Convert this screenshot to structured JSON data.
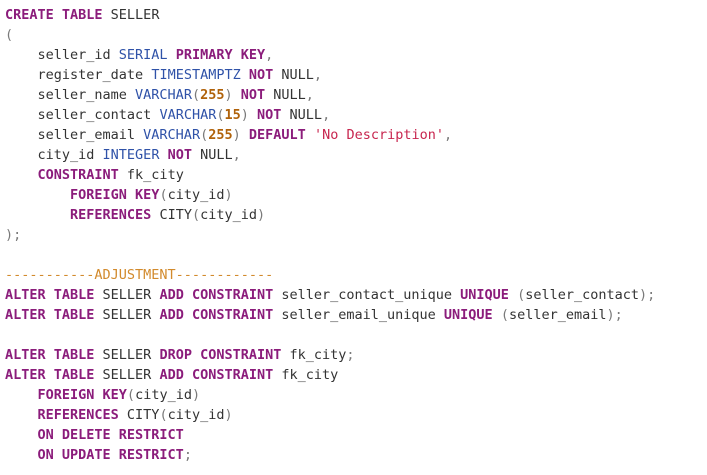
{
  "lines": [
    [
      {
        "t": "CREATE TABLE",
        "c": "kw"
      },
      {
        "t": " SELLER",
        "c": "id"
      }
    ],
    [
      {
        "t": "(",
        "c": "pun"
      }
    ],
    [
      {
        "t": "    seller_id ",
        "c": "id"
      },
      {
        "t": "SERIAL",
        "c": "ty"
      },
      {
        "t": " ",
        "c": "pl"
      },
      {
        "t": "PRIMARY KEY",
        "c": "kw"
      },
      {
        "t": ",",
        "c": "pun"
      }
    ],
    [
      {
        "t": "    register_date ",
        "c": "id"
      },
      {
        "t": "TIMESTAMPTZ",
        "c": "ty"
      },
      {
        "t": " ",
        "c": "pl"
      },
      {
        "t": "NOT",
        "c": "kw"
      },
      {
        "t": " NULL",
        "c": "id"
      },
      {
        "t": ",",
        "c": "pun"
      }
    ],
    [
      {
        "t": "    seller_name ",
        "c": "id"
      },
      {
        "t": "VARCHAR",
        "c": "ty"
      },
      {
        "t": "(",
        "c": "pun"
      },
      {
        "t": "255",
        "c": "num"
      },
      {
        "t": ")",
        "c": "pun"
      },
      {
        "t": " ",
        "c": "pl"
      },
      {
        "t": "NOT",
        "c": "kw"
      },
      {
        "t": " NULL",
        "c": "id"
      },
      {
        "t": ",",
        "c": "pun"
      }
    ],
    [
      {
        "t": "    seller_contact ",
        "c": "id"
      },
      {
        "t": "VARCHAR",
        "c": "ty"
      },
      {
        "t": "(",
        "c": "pun"
      },
      {
        "t": "15",
        "c": "num"
      },
      {
        "t": ")",
        "c": "pun"
      },
      {
        "t": " ",
        "c": "pl"
      },
      {
        "t": "NOT",
        "c": "kw"
      },
      {
        "t": " NULL",
        "c": "id"
      },
      {
        "t": ",",
        "c": "pun"
      }
    ],
    [
      {
        "t": "    seller_email ",
        "c": "id"
      },
      {
        "t": "VARCHAR",
        "c": "ty"
      },
      {
        "t": "(",
        "c": "pun"
      },
      {
        "t": "255",
        "c": "num"
      },
      {
        "t": ")",
        "c": "pun"
      },
      {
        "t": " ",
        "c": "pl"
      },
      {
        "t": "DEFAULT",
        "c": "kw"
      },
      {
        "t": " ",
        "c": "pl"
      },
      {
        "t": "'No Description'",
        "c": "str"
      },
      {
        "t": ",",
        "c": "pun"
      }
    ],
    [
      {
        "t": "    city_id ",
        "c": "id"
      },
      {
        "t": "INTEGER",
        "c": "ty"
      },
      {
        "t": " ",
        "c": "pl"
      },
      {
        "t": "NOT",
        "c": "kw"
      },
      {
        "t": " NULL",
        "c": "id"
      },
      {
        "t": ",",
        "c": "pun"
      }
    ],
    [
      {
        "t": "    ",
        "c": "pl"
      },
      {
        "t": "CONSTRAINT",
        "c": "kw"
      },
      {
        "t": " fk_city",
        "c": "id"
      }
    ],
    [
      {
        "t": "        ",
        "c": "pl"
      },
      {
        "t": "FOREIGN KEY",
        "c": "kw"
      },
      {
        "t": "(",
        "c": "pun"
      },
      {
        "t": "city_id",
        "c": "id"
      },
      {
        "t": ")",
        "c": "pun"
      }
    ],
    [
      {
        "t": "        ",
        "c": "pl"
      },
      {
        "t": "REFERENCES",
        "c": "kw"
      },
      {
        "t": " CITY",
        "c": "id"
      },
      {
        "t": "(",
        "c": "pun"
      },
      {
        "t": "city_id",
        "c": "id"
      },
      {
        "t": ")",
        "c": "pun"
      }
    ],
    [
      {
        "t": ");",
        "c": "pun"
      }
    ],
    [],
    [
      {
        "t": "-----------ADJUSTMENT------------",
        "c": "cmt"
      }
    ],
    [
      {
        "t": "ALTER TABLE",
        "c": "kw"
      },
      {
        "t": " SELLER ",
        "c": "id"
      },
      {
        "t": "ADD CONSTRAINT",
        "c": "kw"
      },
      {
        "t": " seller_contact_unique ",
        "c": "id"
      },
      {
        "t": "UNIQUE",
        "c": "kw"
      },
      {
        "t": " ",
        "c": "pl"
      },
      {
        "t": "(",
        "c": "pun"
      },
      {
        "t": "seller_contact",
        "c": "id"
      },
      {
        "t": ");",
        "c": "pun"
      }
    ],
    [
      {
        "t": "ALTER TABLE",
        "c": "kw"
      },
      {
        "t": " SELLER ",
        "c": "id"
      },
      {
        "t": "ADD CONSTRAINT",
        "c": "kw"
      },
      {
        "t": " seller_email_unique ",
        "c": "id"
      },
      {
        "t": "UNIQUE",
        "c": "kw"
      },
      {
        "t": " ",
        "c": "pl"
      },
      {
        "t": "(",
        "c": "pun"
      },
      {
        "t": "seller_email",
        "c": "id"
      },
      {
        "t": ");",
        "c": "pun"
      }
    ],
    [],
    [
      {
        "t": "ALTER TABLE",
        "c": "kw"
      },
      {
        "t": " SELLER ",
        "c": "id"
      },
      {
        "t": "DROP CONSTRAINT",
        "c": "kw"
      },
      {
        "t": " fk_city",
        "c": "id"
      },
      {
        "t": ";",
        "c": "pun"
      }
    ],
    [
      {
        "t": "ALTER TABLE",
        "c": "kw"
      },
      {
        "t": " SELLER ",
        "c": "id"
      },
      {
        "t": "ADD CONSTRAINT",
        "c": "kw"
      },
      {
        "t": " fk_city",
        "c": "id"
      }
    ],
    [
      {
        "t": "    ",
        "c": "pl"
      },
      {
        "t": "FOREIGN KEY",
        "c": "kw"
      },
      {
        "t": "(",
        "c": "pun"
      },
      {
        "t": "city_id",
        "c": "id"
      },
      {
        "t": ")",
        "c": "pun"
      }
    ],
    [
      {
        "t": "    ",
        "c": "pl"
      },
      {
        "t": "REFERENCES",
        "c": "kw"
      },
      {
        "t": " CITY",
        "c": "id"
      },
      {
        "t": "(",
        "c": "pun"
      },
      {
        "t": "city_id",
        "c": "id"
      },
      {
        "t": ")",
        "c": "pun"
      }
    ],
    [
      {
        "t": "    ",
        "c": "pl"
      },
      {
        "t": "ON DELETE RESTRICT",
        "c": "kw"
      }
    ],
    [
      {
        "t": "    ",
        "c": "pl"
      },
      {
        "t": "ON UPDATE RESTRICT",
        "c": "kw"
      },
      {
        "t": ";",
        "c": "pun"
      }
    ]
  ],
  "colors": {
    "keyword": "#8b1c7b",
    "type": "#2f52a8",
    "number": "#b0620a",
    "string": "#c7254e",
    "comment": "#d28a2c",
    "punctuation": "#7a7a7a",
    "text": "#333333",
    "background": "#ffffff"
  }
}
